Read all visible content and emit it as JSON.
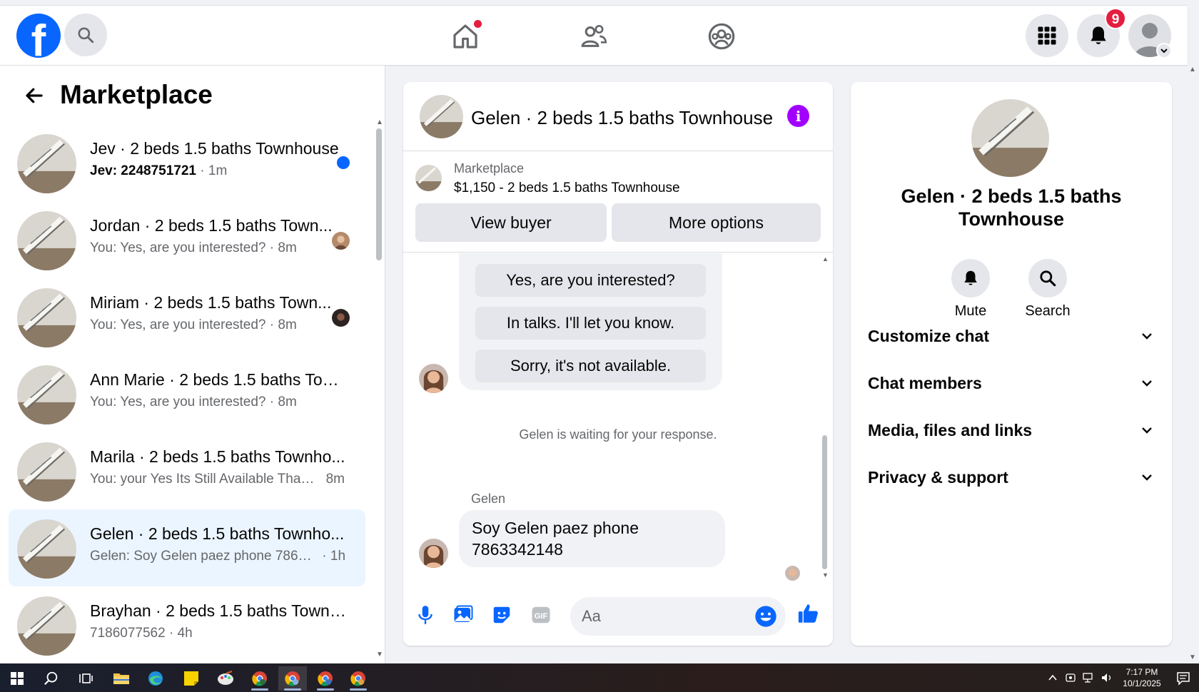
{
  "topbar": {
    "logo_letter": "f",
    "notification_count": "9"
  },
  "sidebar": {
    "title": "Marketplace",
    "conversations": [
      {
        "title": "Jev · 2 beds 1.5 baths Townhouse",
        "preview": "Jev: 2248751721",
        "time": "1m",
        "unread": true
      },
      {
        "title": "Jordan · 2 beds 1.5 baths Town...",
        "preview": "You: Yes, are you interested?",
        "time": "8m"
      },
      {
        "title": "Miriam · 2 beds 1.5 baths Town...",
        "preview": "You: Yes, are you interested?",
        "time": "8m"
      },
      {
        "title": "Ann Marie · 2 beds 1.5 baths Tow...",
        "preview": "You: Yes, are you interested?",
        "time": "8m"
      },
      {
        "title": "Marila · 2 beds 1.5 baths Townho...",
        "preview": "You: your Yes Its Still Available Than...",
        "time": "8m"
      },
      {
        "title": "Gelen · 2 beds 1.5 baths Townho...",
        "preview": "Gelen: Soy Gelen paez phone 78633...",
        "time": "1h",
        "active": true
      },
      {
        "title": "Brayhan · 2 beds 1.5 baths Townh...",
        "preview": "7186077562",
        "time": "4h"
      }
    ]
  },
  "chat": {
    "header_title": "Gelen · 2 beds 1.5 baths Townhouse",
    "info_glyph": "i",
    "marketplace_label": "Marketplace",
    "listing": "$1,150 - 2 beds 1.5 baths Townhouse",
    "view_buyer": "View buyer",
    "more_options": "More options",
    "quick_replies": [
      "Yes, are you interested?",
      "In talks. I'll let you know.",
      "Sorry, it's not available."
    ],
    "status": "Gelen is waiting for your response.",
    "sender": "Gelen",
    "message": "Soy Gelen paez phone 7863342148",
    "composer_placeholder": "Aa",
    "gif_label": "GIF"
  },
  "right_panel": {
    "name": "Gelen · 2 beds 1.5 baths Townhouse",
    "mute_label": "Mute",
    "search_label": "Search",
    "sections": [
      "Customize chat",
      "Chat members",
      "Media, files and links",
      "Privacy & support"
    ]
  },
  "taskbar": {
    "time": "7:17 PM",
    "date": "10/1/2025"
  },
  "colors": {
    "brand_blue": "#0866ff",
    "badge_red": "#e41e3f",
    "info_purple": "#a100ff",
    "active_row": "#ebf5ff"
  }
}
